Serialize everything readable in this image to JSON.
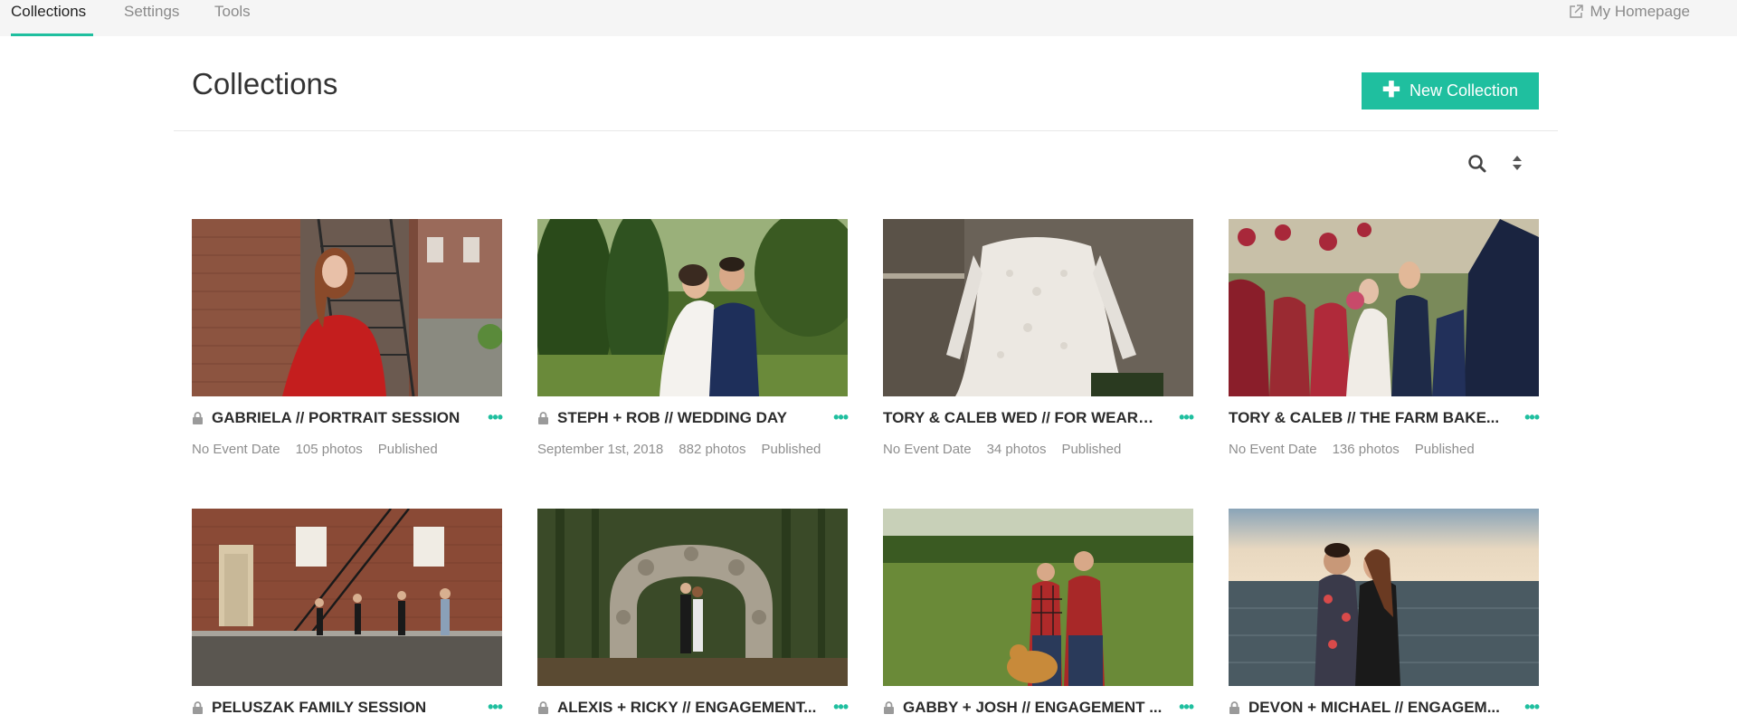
{
  "nav": {
    "tabs": [
      {
        "label": "Collections"
      },
      {
        "label": "Settings"
      },
      {
        "label": "Tools"
      }
    ],
    "homepage_label": "My Homepage"
  },
  "header": {
    "title": "Collections",
    "new_button_label": "New Collection"
  },
  "colors": {
    "accent": "#1fbf9f"
  },
  "icons": [
    "external-link-icon",
    "plus-icon",
    "search-icon",
    "sort-icon",
    "lock-icon",
    "more-icon"
  ],
  "collections": [
    {
      "title": "GABRIELA // PORTRAIT SESSION",
      "locked": true,
      "date": "No Event Date",
      "photos": "105 photos",
      "status": "Published"
    },
    {
      "title": "STEPH + ROB // WEDDING DAY",
      "locked": true,
      "date": "September 1st, 2018",
      "photos": "882 photos",
      "status": "Published"
    },
    {
      "title": "TORY & CALEB WED // FOR WEAR ...",
      "locked": false,
      "date": "No Event Date",
      "photos": "34 photos",
      "status": "Published"
    },
    {
      "title": "TORY & CALEB // THE FARM BAKE...",
      "locked": false,
      "date": "No Event Date",
      "photos": "136 photos",
      "status": "Published"
    },
    {
      "title": "PELUSZAK FAMILY SESSION",
      "locked": true
    },
    {
      "title": "ALEXIS + RICKY // ENGAGEMENT...",
      "locked": true
    },
    {
      "title": "GABBY + JOSH // ENGAGEMENT ...",
      "locked": true
    },
    {
      "title": "DEVON + MICHAEL // ENGAGEM...",
      "locked": true
    }
  ]
}
